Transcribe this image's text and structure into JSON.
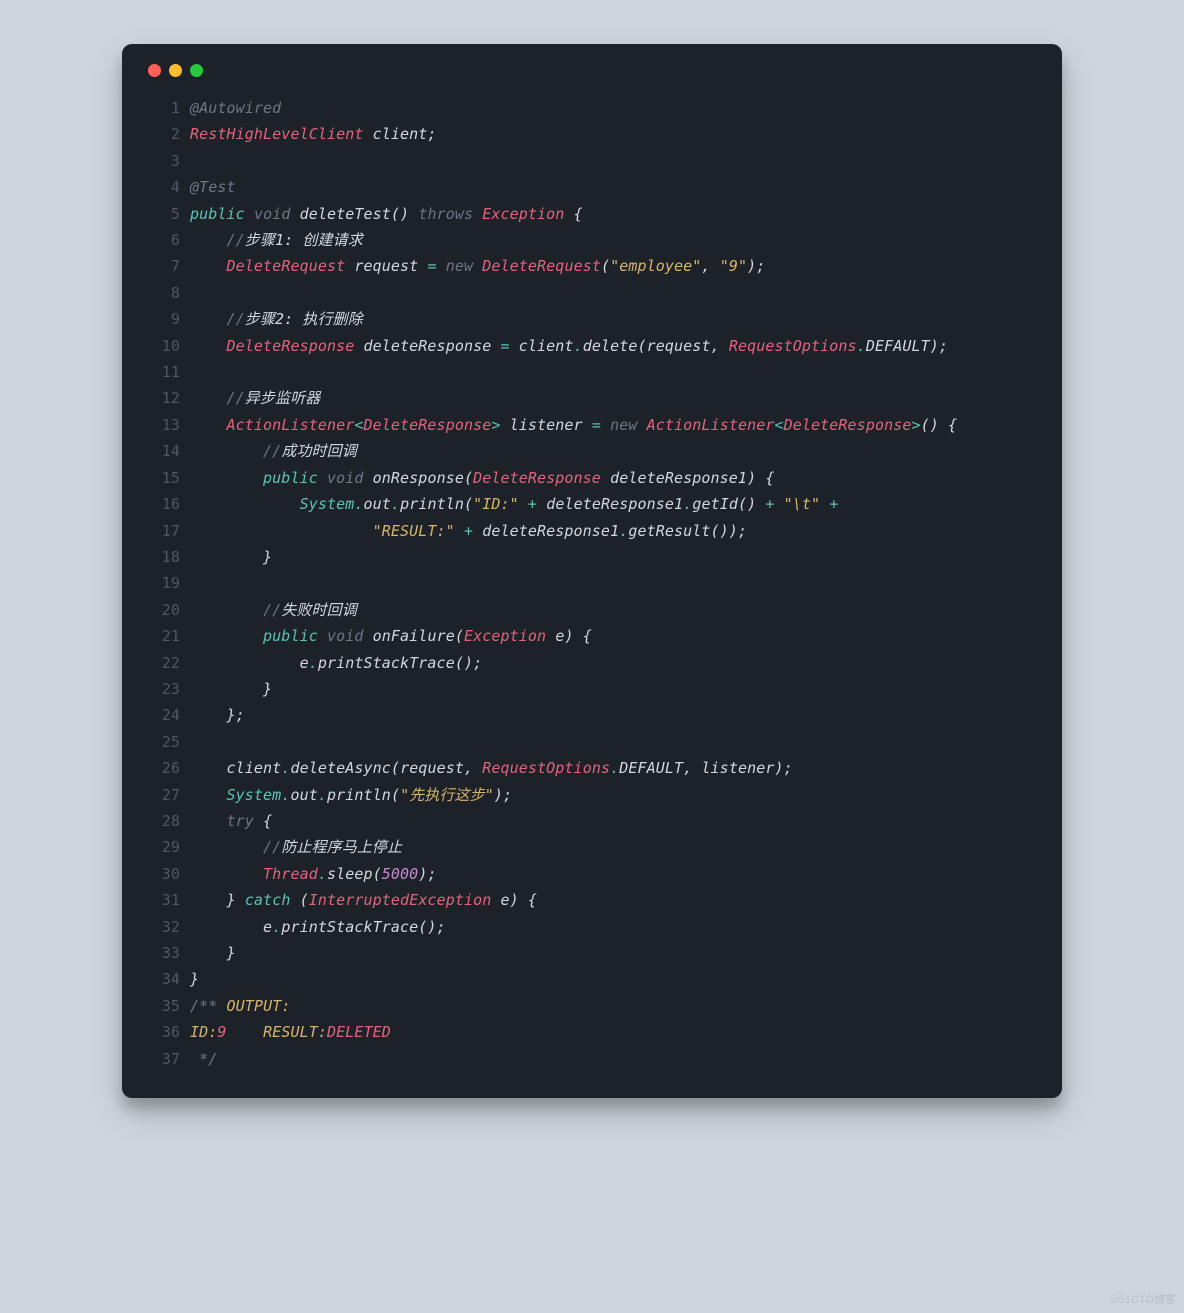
{
  "window": {
    "dots": [
      "red",
      "yellow",
      "green"
    ]
  },
  "code": {
    "lines": [
      {
        "n": "1",
        "tokens": [
          {
            "c": "c-gray",
            "t": "@Autowired"
          }
        ]
      },
      {
        "n": "2",
        "tokens": [
          {
            "c": "c-type",
            "t": "RestHighLevelClient"
          },
          {
            "c": "c-ident",
            "t": " client"
          },
          {
            "c": "c-punc",
            "t": ";"
          }
        ]
      },
      {
        "n": "3",
        "tokens": [
          {
            "c": "c-default",
            "t": ""
          }
        ]
      },
      {
        "n": "4",
        "tokens": [
          {
            "c": "c-gray",
            "t": "@Test"
          }
        ]
      },
      {
        "n": "5",
        "tokens": [
          {
            "c": "c-keyword",
            "t": "public"
          },
          {
            "c": "c-default",
            "t": " "
          },
          {
            "c": "c-gray",
            "t": "void"
          },
          {
            "c": "c-default",
            "t": " "
          },
          {
            "c": "c-ident",
            "t": "deleteTest"
          },
          {
            "c": "c-punc",
            "t": "()"
          },
          {
            "c": "c-default",
            "t": " "
          },
          {
            "c": "c-gray",
            "t": "throws"
          },
          {
            "c": "c-default",
            "t": " "
          },
          {
            "c": "c-type",
            "t": "Exception"
          },
          {
            "c": "c-default",
            "t": " "
          },
          {
            "c": "c-punc",
            "t": "{"
          }
        ]
      },
      {
        "n": "6",
        "tokens": [
          {
            "c": "c-default",
            "t": "    "
          },
          {
            "c": "c-comment",
            "t": "//"
          },
          {
            "c": "c-commentw",
            "t": "步骤1: 创建请求"
          }
        ]
      },
      {
        "n": "7",
        "tokens": [
          {
            "c": "c-default",
            "t": "    "
          },
          {
            "c": "c-type",
            "t": "DeleteRequest"
          },
          {
            "c": "c-default",
            "t": " "
          },
          {
            "c": "c-ident",
            "t": "request"
          },
          {
            "c": "c-default",
            "t": " "
          },
          {
            "c": "c-op",
            "t": "="
          },
          {
            "c": "c-default",
            "t": " "
          },
          {
            "c": "c-gray",
            "t": "new"
          },
          {
            "c": "c-default",
            "t": " "
          },
          {
            "c": "c-type",
            "t": "DeleteRequest"
          },
          {
            "c": "c-punc",
            "t": "("
          },
          {
            "c": "c-string",
            "t": "\"employee\""
          },
          {
            "c": "c-punc",
            "t": ", "
          },
          {
            "c": "c-string",
            "t": "\"9\""
          },
          {
            "c": "c-punc",
            "t": ");"
          }
        ]
      },
      {
        "n": "8",
        "tokens": [
          {
            "c": "c-default",
            "t": ""
          }
        ]
      },
      {
        "n": "9",
        "tokens": [
          {
            "c": "c-default",
            "t": "    "
          },
          {
            "c": "c-comment",
            "t": "//"
          },
          {
            "c": "c-commentw",
            "t": "步骤2: 执行删除"
          }
        ]
      },
      {
        "n": "10",
        "tokens": [
          {
            "c": "c-default",
            "t": "    "
          },
          {
            "c": "c-type",
            "t": "DeleteResponse"
          },
          {
            "c": "c-default",
            "t": " "
          },
          {
            "c": "c-ident",
            "t": "deleteResponse"
          },
          {
            "c": "c-default",
            "t": " "
          },
          {
            "c": "c-op",
            "t": "="
          },
          {
            "c": "c-default",
            "t": " "
          },
          {
            "c": "c-ident",
            "t": "client"
          },
          {
            "c": "c-dot",
            "t": "."
          },
          {
            "c": "c-ident",
            "t": "delete"
          },
          {
            "c": "c-punc",
            "t": "("
          },
          {
            "c": "c-ident",
            "t": "request"
          },
          {
            "c": "c-punc",
            "t": ", "
          },
          {
            "c": "c-type",
            "t": "RequestOptions"
          },
          {
            "c": "c-dot",
            "t": "."
          },
          {
            "c": "c-ident",
            "t": "DEFAULT"
          },
          {
            "c": "c-punc",
            "t": ");"
          }
        ]
      },
      {
        "n": "11",
        "tokens": [
          {
            "c": "c-default",
            "t": ""
          }
        ]
      },
      {
        "n": "12",
        "tokens": [
          {
            "c": "c-default",
            "t": "    "
          },
          {
            "c": "c-comment",
            "t": "//"
          },
          {
            "c": "c-commentw",
            "t": "异步监听器"
          }
        ]
      },
      {
        "n": "13",
        "tokens": [
          {
            "c": "c-default",
            "t": "    "
          },
          {
            "c": "c-type",
            "t": "ActionListener"
          },
          {
            "c": "c-op",
            "t": "<"
          },
          {
            "c": "c-type",
            "t": "DeleteResponse"
          },
          {
            "c": "c-op",
            "t": ">"
          },
          {
            "c": "c-default",
            "t": " "
          },
          {
            "c": "c-ident",
            "t": "listener"
          },
          {
            "c": "c-default",
            "t": " "
          },
          {
            "c": "c-op",
            "t": "="
          },
          {
            "c": "c-default",
            "t": " "
          },
          {
            "c": "c-gray",
            "t": "new"
          },
          {
            "c": "c-default",
            "t": " "
          },
          {
            "c": "c-type",
            "t": "ActionListener"
          },
          {
            "c": "c-op",
            "t": "<"
          },
          {
            "c": "c-type",
            "t": "DeleteResponse"
          },
          {
            "c": "c-op",
            "t": ">"
          },
          {
            "c": "c-punc",
            "t": "() {"
          }
        ]
      },
      {
        "n": "14",
        "tokens": [
          {
            "c": "c-default",
            "t": "        "
          },
          {
            "c": "c-comment",
            "t": "//"
          },
          {
            "c": "c-commentw",
            "t": "成功时回调"
          }
        ]
      },
      {
        "n": "15",
        "tokens": [
          {
            "c": "c-default",
            "t": "        "
          },
          {
            "c": "c-keyword",
            "t": "public"
          },
          {
            "c": "c-default",
            "t": " "
          },
          {
            "c": "c-gray",
            "t": "void"
          },
          {
            "c": "c-default",
            "t": " "
          },
          {
            "c": "c-ident",
            "t": "onResponse"
          },
          {
            "c": "c-punc",
            "t": "("
          },
          {
            "c": "c-type",
            "t": "DeleteResponse"
          },
          {
            "c": "c-default",
            "t": " "
          },
          {
            "c": "c-ident",
            "t": "deleteResponse1"
          },
          {
            "c": "c-punc",
            "t": ") {"
          }
        ]
      },
      {
        "n": "16",
        "tokens": [
          {
            "c": "c-default",
            "t": "            "
          },
          {
            "c": "c-system",
            "t": "System"
          },
          {
            "c": "c-dot",
            "t": "."
          },
          {
            "c": "c-ident",
            "t": "out"
          },
          {
            "c": "c-dot",
            "t": "."
          },
          {
            "c": "c-ident",
            "t": "println"
          },
          {
            "c": "c-punc",
            "t": "("
          },
          {
            "c": "c-string",
            "t": "\"ID:\""
          },
          {
            "c": "c-default",
            "t": " "
          },
          {
            "c": "c-op",
            "t": "+"
          },
          {
            "c": "c-default",
            "t": " "
          },
          {
            "c": "c-ident",
            "t": "deleteResponse1"
          },
          {
            "c": "c-dot",
            "t": "."
          },
          {
            "c": "c-ident",
            "t": "getId"
          },
          {
            "c": "c-punc",
            "t": "()"
          },
          {
            "c": "c-default",
            "t": " "
          },
          {
            "c": "c-op",
            "t": "+"
          },
          {
            "c": "c-default",
            "t": " "
          },
          {
            "c": "c-string",
            "t": "\"\\t\""
          },
          {
            "c": "c-default",
            "t": " "
          },
          {
            "c": "c-op",
            "t": "+"
          }
        ]
      },
      {
        "n": "17",
        "tokens": [
          {
            "c": "c-default",
            "t": "                    "
          },
          {
            "c": "c-string",
            "t": "\"RESULT:\""
          },
          {
            "c": "c-default",
            "t": " "
          },
          {
            "c": "c-op",
            "t": "+"
          },
          {
            "c": "c-default",
            "t": " "
          },
          {
            "c": "c-ident",
            "t": "deleteResponse1"
          },
          {
            "c": "c-dot",
            "t": "."
          },
          {
            "c": "c-ident",
            "t": "getResult"
          },
          {
            "c": "c-punc",
            "t": "());"
          }
        ]
      },
      {
        "n": "18",
        "tokens": [
          {
            "c": "c-default",
            "t": "        "
          },
          {
            "c": "c-punc",
            "t": "}"
          }
        ]
      },
      {
        "n": "19",
        "tokens": [
          {
            "c": "c-default",
            "t": ""
          }
        ]
      },
      {
        "n": "20",
        "tokens": [
          {
            "c": "c-default",
            "t": "        "
          },
          {
            "c": "c-comment",
            "t": "//"
          },
          {
            "c": "c-commentw",
            "t": "失败时回调"
          }
        ]
      },
      {
        "n": "21",
        "tokens": [
          {
            "c": "c-default",
            "t": "        "
          },
          {
            "c": "c-keyword",
            "t": "public"
          },
          {
            "c": "c-default",
            "t": " "
          },
          {
            "c": "c-gray",
            "t": "void"
          },
          {
            "c": "c-default",
            "t": " "
          },
          {
            "c": "c-ident",
            "t": "onFailure"
          },
          {
            "c": "c-punc",
            "t": "("
          },
          {
            "c": "c-type",
            "t": "Exception"
          },
          {
            "c": "c-default",
            "t": " "
          },
          {
            "c": "c-ident",
            "t": "e"
          },
          {
            "c": "c-punc",
            "t": ") {"
          }
        ]
      },
      {
        "n": "22",
        "tokens": [
          {
            "c": "c-default",
            "t": "            "
          },
          {
            "c": "c-ident",
            "t": "e"
          },
          {
            "c": "c-dot",
            "t": "."
          },
          {
            "c": "c-ident",
            "t": "printStackTrace"
          },
          {
            "c": "c-punc",
            "t": "();"
          }
        ]
      },
      {
        "n": "23",
        "tokens": [
          {
            "c": "c-default",
            "t": "        "
          },
          {
            "c": "c-punc",
            "t": "}"
          }
        ]
      },
      {
        "n": "24",
        "tokens": [
          {
            "c": "c-default",
            "t": "    "
          },
          {
            "c": "c-punc",
            "t": "};"
          }
        ]
      },
      {
        "n": "25",
        "tokens": [
          {
            "c": "c-default",
            "t": ""
          }
        ]
      },
      {
        "n": "26",
        "tokens": [
          {
            "c": "c-default",
            "t": "    "
          },
          {
            "c": "c-ident",
            "t": "client"
          },
          {
            "c": "c-dot",
            "t": "."
          },
          {
            "c": "c-ident",
            "t": "deleteAsync"
          },
          {
            "c": "c-punc",
            "t": "("
          },
          {
            "c": "c-ident",
            "t": "request"
          },
          {
            "c": "c-punc",
            "t": ", "
          },
          {
            "c": "c-type",
            "t": "RequestOptions"
          },
          {
            "c": "c-dot",
            "t": "."
          },
          {
            "c": "c-ident",
            "t": "DEFAULT"
          },
          {
            "c": "c-punc",
            "t": ", "
          },
          {
            "c": "c-ident",
            "t": "listener"
          },
          {
            "c": "c-punc",
            "t": ");"
          }
        ]
      },
      {
        "n": "27",
        "tokens": [
          {
            "c": "c-default",
            "t": "    "
          },
          {
            "c": "c-system",
            "t": "System"
          },
          {
            "c": "c-dot",
            "t": "."
          },
          {
            "c": "c-ident",
            "t": "out"
          },
          {
            "c": "c-dot",
            "t": "."
          },
          {
            "c": "c-ident",
            "t": "println"
          },
          {
            "c": "c-punc",
            "t": "("
          },
          {
            "c": "c-string",
            "t": "\"先执行这步\""
          },
          {
            "c": "c-punc",
            "t": ");"
          }
        ]
      },
      {
        "n": "28",
        "tokens": [
          {
            "c": "c-default",
            "t": "    "
          },
          {
            "c": "c-gray",
            "t": "try"
          },
          {
            "c": "c-default",
            "t": " "
          },
          {
            "c": "c-punc",
            "t": "{"
          }
        ]
      },
      {
        "n": "29",
        "tokens": [
          {
            "c": "c-default",
            "t": "        "
          },
          {
            "c": "c-comment",
            "t": "//"
          },
          {
            "c": "c-commentw",
            "t": "防止程序马上停止"
          }
        ]
      },
      {
        "n": "30",
        "tokens": [
          {
            "c": "c-default",
            "t": "        "
          },
          {
            "c": "c-type",
            "t": "Thread"
          },
          {
            "c": "c-dot",
            "t": "."
          },
          {
            "c": "c-ident",
            "t": "sleep"
          },
          {
            "c": "c-punc",
            "t": "("
          },
          {
            "c": "c-num",
            "t": "5000"
          },
          {
            "c": "c-punc",
            "t": ");"
          }
        ]
      },
      {
        "n": "31",
        "tokens": [
          {
            "c": "c-default",
            "t": "    "
          },
          {
            "c": "c-punc",
            "t": "}"
          },
          {
            "c": "c-default",
            "t": " "
          },
          {
            "c": "c-keyword",
            "t": "catch"
          },
          {
            "c": "c-default",
            "t": " "
          },
          {
            "c": "c-punc",
            "t": "("
          },
          {
            "c": "c-type",
            "t": "InterruptedException"
          },
          {
            "c": "c-default",
            "t": " "
          },
          {
            "c": "c-ident",
            "t": "e"
          },
          {
            "c": "c-punc",
            "t": ") {"
          }
        ]
      },
      {
        "n": "32",
        "tokens": [
          {
            "c": "c-default",
            "t": "        "
          },
          {
            "c": "c-ident",
            "t": "e"
          },
          {
            "c": "c-dot",
            "t": "."
          },
          {
            "c": "c-ident",
            "t": "printStackTrace"
          },
          {
            "c": "c-punc",
            "t": "();"
          }
        ]
      },
      {
        "n": "33",
        "tokens": [
          {
            "c": "c-default",
            "t": "    "
          },
          {
            "c": "c-punc",
            "t": "}"
          }
        ]
      },
      {
        "n": "34",
        "tokens": [
          {
            "c": "c-punc",
            "t": "}"
          }
        ]
      },
      {
        "n": "35",
        "tokens": [
          {
            "c": "c-comment",
            "t": "/**"
          },
          {
            "c": "c-default",
            "t": " "
          },
          {
            "c": "c-yellow",
            "t": "OUTPUT:"
          }
        ]
      },
      {
        "n": "36",
        "tokens": [
          {
            "c": "c-yellow",
            "t": "ID:"
          },
          {
            "c": "c-type",
            "t": "9"
          },
          {
            "c": "c-default",
            "t": "    "
          },
          {
            "c": "c-yellow",
            "t": "RESULT:"
          },
          {
            "c": "c-type",
            "t": "DELETED"
          }
        ]
      },
      {
        "n": "37",
        "tokens": [
          {
            "c": "c-default",
            "t": " "
          },
          {
            "c": "c-comment",
            "t": "*/"
          }
        ]
      }
    ]
  },
  "watermark": "©51CTO博客"
}
